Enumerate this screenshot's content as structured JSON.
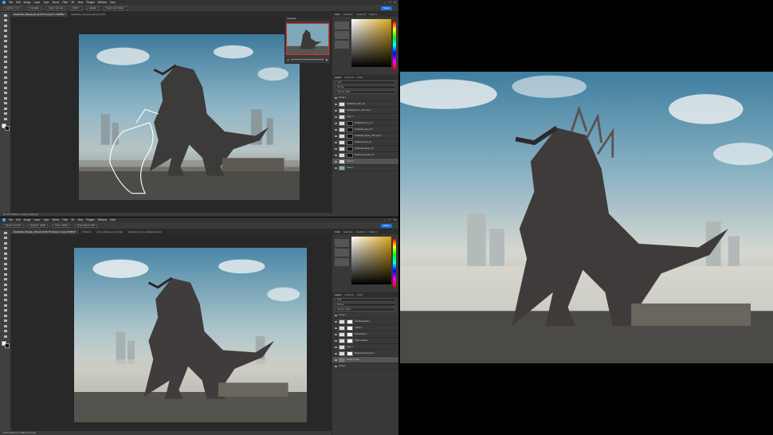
{
  "top_window": {
    "menu": [
      "File",
      "Edit",
      "Image",
      "Layer",
      "Type",
      "Select",
      "Filter",
      "3D",
      "View",
      "Plugins",
      "Window",
      "Help"
    ],
    "options": [
      "Feather: 0 px",
      "Anti-alias",
      "Style: Normal",
      "Width:",
      "Height:",
      "Select and Mask..."
    ],
    "share_label": "Share",
    "tabs": [
      "Deathclaw_Beastly.psb @ 66.7% (Layer 0, RGB/8) *",
      "deathclaw_reference.psd @ 33.3%"
    ],
    "status": "66.67%   1920 px x 1080 px (96 ppi)",
    "navigator_label": "Navigator",
    "color_tabs": [
      "Color",
      "Swatches",
      "Gradients",
      "Patterns"
    ],
    "layer_tabs": [
      "Layers",
      "Channels",
      "Paths"
    ],
    "layer_controls": [
      "Kind",
      "Normal",
      "Opacity: 100%",
      "Lock:",
      "Fill: 100%"
    ],
    "layers": [
      "Group 1",
      "Deathclaw_Skin_01",
      "Deathclaw_01_07% copy 2",
      "Layer 3",
      "Deathclaw_Arm_07",
      "Deathclaw_Eye_07",
      "Deathclaw_Base_07% copy 3",
      "Deathclaw_Fin_07",
      "Deathclaw_Body_07",
      "Deathclaw_Head_07",
      "Layer 2",
      "Layer 1"
    ]
  },
  "bottom_window": {
    "menu": [
      "File",
      "Edit",
      "Image",
      "Layer",
      "Type",
      "Select",
      "Filter",
      "3D",
      "View",
      "Plugins",
      "Window",
      "Help"
    ],
    "options": [
      "Mode: Normal",
      "Opacity: 100%",
      "Flow: 100%",
      "Smoothing: 10%"
    ],
    "share_label": "Share",
    "tabs": [
      "Deathclaw_Beastly_v03.psb @ 66.7% (Group 1 copy, RGB/8) *",
      "Untitled-1",
      "photo_bashing_ref_03.jpg",
      "landscape_ruins_background.psd"
    ],
    "status": "100%   1920 px x 1080 px (72 ppi)",
    "color_tabs": [
      "Color",
      "Swatches",
      "Gradients",
      "Patterns"
    ],
    "layer_tabs": [
      "Layers",
      "Channels",
      "Paths"
    ],
    "layer_controls": [
      "Kind",
      "Normal",
      "Opacity: 100%",
      "Lock:",
      "Fill: 100%"
    ],
    "layers": [
      "Group 1",
      "Hue/Saturation 1",
      "Levels 1",
      "Photo Filter 1",
      "Color Lookup 1",
      "Layer 1",
      "Brightness/Contrast 1",
      "Group 1 copy",
      "Group 1"
    ]
  },
  "colors": {
    "photoshop_bg": "#535353",
    "canvas_bg": "#282828",
    "accent": "#31a8ff",
    "share_button": "#1473e6"
  }
}
